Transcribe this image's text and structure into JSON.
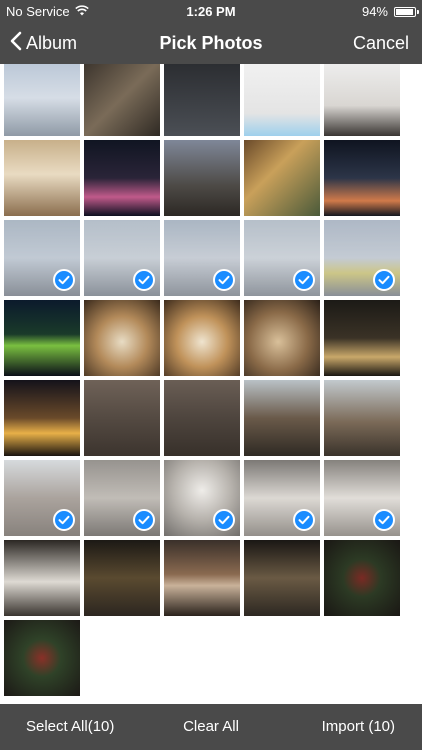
{
  "status_bar": {
    "carrier": "No Service",
    "time": "1:26 PM",
    "battery_text": "94%",
    "battery_level": 0.94,
    "wifi_icon": "wifi-icon",
    "battery_icon": "battery-icon"
  },
  "nav": {
    "back_label": "Album",
    "title": "Pick Photos",
    "cancel_label": "Cancel",
    "back_icon": "chevron-left-icon"
  },
  "toolbar": {
    "select_all_label": "Select All(10)",
    "clear_all_label": "Clear All",
    "import_label": "Import (10)"
  },
  "colors": {
    "bar_background": "#4a4a4a",
    "check_blue": "#1a8cff"
  },
  "photos": [
    {
      "name": "photo-harbor-waterfront",
      "selected": false,
      "bg": "linear-gradient(180deg,#b9c6d6 0%,#d6dde6 50%,#8f9aa6 100%)"
    },
    {
      "name": "photo-screenshot-grid",
      "selected": false,
      "bg": "linear-gradient(135deg,#3a332c 0%,#7a6b58 50%,#2f2a24 100%)"
    },
    {
      "name": "photo-file-list-screenshot",
      "selected": false,
      "bg": "linear-gradient(180deg,#2a2c30 0%,#4b4f55 100%)"
    },
    {
      "name": "photo-settings-screenshot",
      "selected": false,
      "bg": "linear-gradient(180deg,#f2f2f2 0%,#e4e4e4 70%,#9ed0ec 100%)"
    },
    {
      "name": "photo-living-room",
      "selected": false,
      "bg": "linear-gradient(180deg,#efefef 0%,#d9d6d2 60%,#3a3633 100%)"
    },
    {
      "name": "photo-hotel-lounge",
      "selected": false,
      "bg": "linear-gradient(180deg,#c8b08a 0%,#e9dbc2 45%,#8b6e4e 100%)"
    },
    {
      "name": "photo-night-river-1",
      "selected": false,
      "bg": "linear-gradient(180deg,#101522 0%,#2a2438 50%,#c05a8a 75%,#0d1020 100%)"
    },
    {
      "name": "photo-cathedral",
      "selected": false,
      "bg": "linear-gradient(180deg,#7f8798 0%,#4d4a46 60%,#2c2824 100%)"
    },
    {
      "name": "photo-beverage-cans",
      "selected": false,
      "bg": "linear-gradient(135deg,#6a4a2a 0%,#c9a05a 40%,#4a5a3a 100%)"
    },
    {
      "name": "photo-night-street",
      "selected": false,
      "bg": "linear-gradient(180deg,#0f1420 0%,#2c3548 50%,#d07a4a 80%,#151820 100%)"
    },
    {
      "name": "photo-canton-tower-1",
      "selected": true,
      "bg": "linear-gradient(180deg,#8c9cad 0%,#a9b5c3 50%,#5c6470 100%)"
    },
    {
      "name": "photo-skyline-haze-1",
      "selected": true,
      "bg": "linear-gradient(180deg,#98a6b5 0%,#b3bcc6 50%,#5e6773 100%)"
    },
    {
      "name": "photo-canton-tower-2",
      "selected": true,
      "bg": "linear-gradient(180deg,#8a9aac 0%,#b2bac5 50%,#636b76 100%)"
    },
    {
      "name": "photo-skyline-haze-2",
      "selected": true,
      "bg": "linear-gradient(180deg,#9aa7b5 0%,#b8c0c9 50%,#646c77 100%)"
    },
    {
      "name": "photo-arch-bridge-1",
      "selected": true,
      "bg": "linear-gradient(180deg,#8f9db0 0%,#adb7c3 50%,#b9b05a 70%,#5c6470 100%)"
    },
    {
      "name": "photo-arch-bridge-night",
      "selected": false,
      "bg": "linear-gradient(180deg,#0b1a2c 0%,#1a3a2a 45%,#7ac040 60%,#0a0f18 100%)"
    },
    {
      "name": "photo-dessert-plate-1",
      "selected": false,
      "bg": "radial-gradient(circle at 50% 55%,#e8dcc4 0%,#b38a5a 45%,#3a2a1c 100%)"
    },
    {
      "name": "photo-dessert-plate-2",
      "selected": false,
      "bg": "radial-gradient(circle at 50% 55%,#efe4cf 0%,#c0925a 45%,#3e2c1d 100%)"
    },
    {
      "name": "photo-dinner-table",
      "selected": false,
      "bg": "radial-gradient(circle at 45% 55%,#d9c09a 0%,#8a6a48 50%,#2a2018 100%)"
    },
    {
      "name": "photo-outdoor-terrace",
      "selected": false,
      "bg": "linear-gradient(180deg,#1c1a16 0%,#3a3226 50%,#c9a86a 75%,#1a1712 100%)"
    },
    {
      "name": "photo-night-storefront",
      "selected": false,
      "bg": "linear-gradient(180deg,#14121a 0%,#6a4a2a 50%,#e8b048 70%,#1a1410 100%)"
    },
    {
      "name": "photo-carved-wall-1",
      "selected": false,
      "bg": "linear-gradient(180deg,#6f6258 0%,#544a42 50%,#3c342e 100%)"
    },
    {
      "name": "photo-carved-wall-2",
      "selected": false,
      "bg": "linear-gradient(180deg,#6a5e55 0%,#4e453e 50%,#37302a 100%)"
    },
    {
      "name": "photo-temple-courtyard",
      "selected": false,
      "bg": "linear-gradient(180deg,#b9c1c6 0%,#6a5a4a 50%,#2f2a24 100%)"
    },
    {
      "name": "photo-temple-gate",
      "selected": false,
      "bg": "linear-gradient(180deg,#c2c9cd 0%,#7b6a58 55%,#3a332b 100%)"
    },
    {
      "name": "photo-temple-roof",
      "selected": true,
      "bg": "linear-gradient(180deg,#c7ccd0 0%,#8a8078 50%,#5a524b 100%)"
    },
    {
      "name": "photo-atrium-1",
      "selected": true,
      "bg": "linear-gradient(180deg,#6f6a64 0%,#a9a39b 50%,#4a4540 100%)"
    },
    {
      "name": "photo-chandelier",
      "selected": true,
      "bg": "radial-gradient(circle at 50% 40%,#e9e6e1 0%,#9a948c 50%,#3b3733 100%)"
    },
    {
      "name": "photo-white-tree-1",
      "selected": true,
      "bg": "linear-gradient(180deg,#4a4641 0%,#cfcac3 50%,#6b655e 100%)"
    },
    {
      "name": "photo-white-tree-2",
      "selected": true,
      "bg": "linear-gradient(180deg,#57524c 0%,#d6d1ca 50%,#6f6962 100%)"
    },
    {
      "name": "photo-white-tree-3",
      "selected": false,
      "bg": "linear-gradient(180deg,#2b2723 0%,#dedad3 55%,#3a3530 100%)"
    },
    {
      "name": "photo-mall-atrium-wreath",
      "selected": false,
      "bg": "linear-gradient(180deg,#1c1915 0%,#5a4a30 50%,#2c2620 100%)"
    },
    {
      "name": "photo-crowded-hall",
      "selected": false,
      "bg": "linear-gradient(180deg,#3a302a 0%,#8a6a50 45%,#c9b29a 60%,#2a221c 100%)"
    },
    {
      "name": "photo-mall-atrium-2",
      "selected": false,
      "bg": "linear-gradient(180deg,#1a1714 0%,#6a5a44 50%,#2d2822 100%)"
    },
    {
      "name": "photo-christmas-wreath-1",
      "selected": false,
      "bg": "radial-gradient(circle at 50% 50%,#7a2a24 0%,#2c3a24 35%,#1a1714 100%)"
    },
    {
      "name": "photo-christmas-wreath-2",
      "selected": false,
      "bg": "radial-gradient(circle at 50% 50%,#8a3028 0%,#2f4228 35%,#1c1916 100%)"
    }
  ]
}
